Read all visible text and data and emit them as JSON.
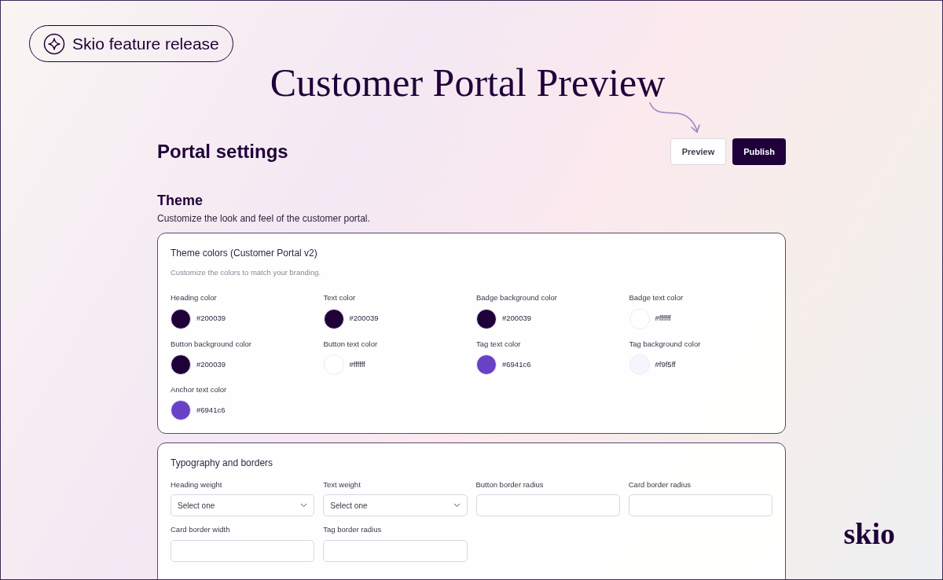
{
  "badge": {
    "label": "Skio feature release"
  },
  "headline": "Customer Portal Preview",
  "page": {
    "title": "Portal settings",
    "buttons": [
      {
        "label": "Preview",
        "kind": "secondary"
      },
      {
        "label": "Publish",
        "kind": "primary"
      }
    ]
  },
  "section": {
    "title": "Theme",
    "description": "Customize the look and feel of the customer portal."
  },
  "colors_card": {
    "title": "Theme colors (Customer Portal v2)",
    "description": "Customize the colors to match your branding.",
    "swatches": [
      {
        "label": "Heading color",
        "value": "#200039",
        "color": "#200039"
      },
      {
        "label": "Text color",
        "value": "#200039",
        "color": "#200039"
      },
      {
        "label": "Badge background color",
        "value": "#200039",
        "color": "#200039"
      },
      {
        "label": "Badge text color",
        "value": "#ffffff",
        "color": "#ffffff"
      },
      {
        "label": "Button background color",
        "value": "#200039",
        "color": "#200039"
      },
      {
        "label": "Button text color",
        "value": "#ffffff",
        "color": "#ffffff"
      },
      {
        "label": "Tag text color",
        "value": "#6941c6",
        "color": "#6941c6"
      },
      {
        "label": "Tag background color",
        "value": "#f9f5ff",
        "color": "#f9f5ff"
      },
      {
        "label": "Anchor text color",
        "value": "#6941c6",
        "color": "#6941c6"
      }
    ]
  },
  "typography_card": {
    "title": "Typography and borders",
    "fields": [
      {
        "label": "Heading weight",
        "kind": "select",
        "placeholder": "Select one"
      },
      {
        "label": "Text weight",
        "kind": "select",
        "placeholder": "Select one"
      },
      {
        "label": "Button border radius",
        "kind": "text"
      },
      {
        "label": "Card border radius",
        "kind": "text"
      },
      {
        "label": "Card border width",
        "kind": "text"
      },
      {
        "label": "Tag border radius",
        "kind": "text"
      }
    ]
  },
  "logo": "skio"
}
